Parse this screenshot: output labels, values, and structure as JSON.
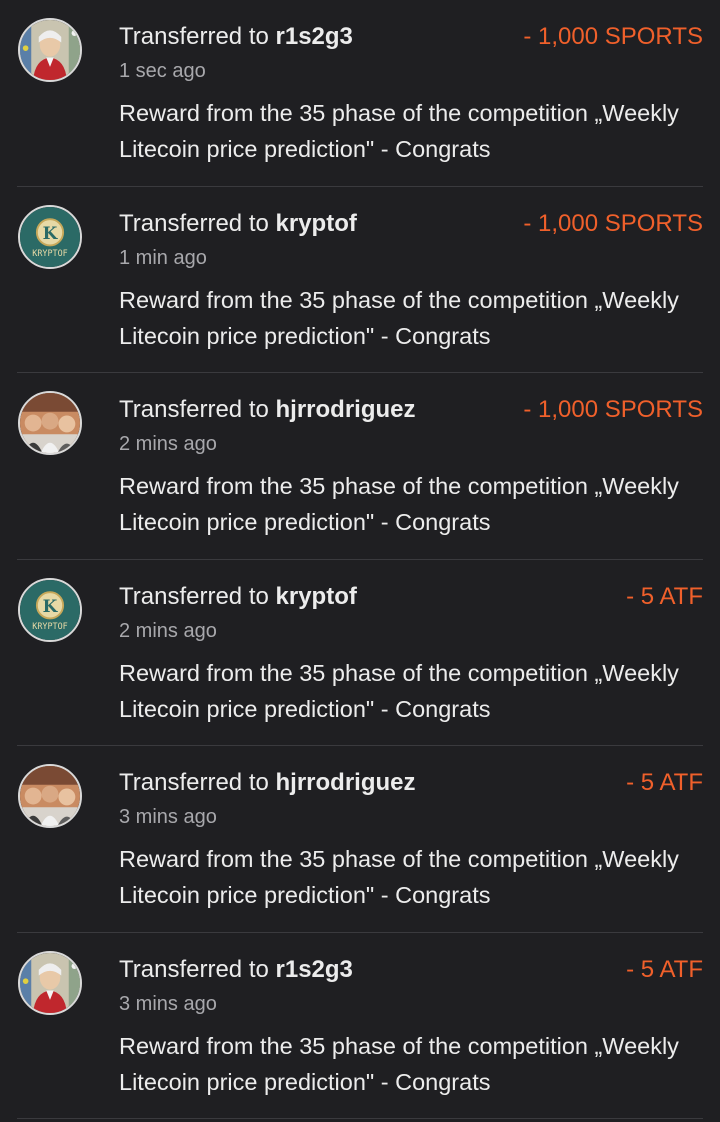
{
  "colors": {
    "background": "#1f1f22",
    "amount": "#f0602b",
    "text": "#ececec",
    "muted": "#a8a8ac",
    "divider": "#3a3a3e"
  },
  "transfers": [
    {
      "prefix": "Transferred to ",
      "user": "r1s2g3",
      "amount": "- 1,000 SPORTS",
      "time": "1 sec ago",
      "memo": "Reward from the 35 phase of the competition „Weekly Litecoin price prediction\" - Congrats",
      "avatar_icon": "portrait-avatar-icon"
    },
    {
      "prefix": "Transferred to ",
      "user": "kryptof",
      "amount": "- 1,000 SPORTS",
      "time": "1 min ago",
      "memo": "Reward from the 35 phase of the competition „Weekly Litecoin price prediction\" - Congrats",
      "avatar_icon": "kryptof-logo-avatar-icon",
      "avatar_logo_text": "KRYPTOF",
      "avatar_logo_letter": "K"
    },
    {
      "prefix": "Transferred to ",
      "user": "hjrrodriguez",
      "amount": "- 1,000 SPORTS",
      "time": "2 mins ago",
      "memo": "Reward from the 35 phase of the competition „Weekly Litecoin price prediction\" - Congrats",
      "avatar_icon": "group-photo-avatar-icon"
    },
    {
      "prefix": "Transferred to ",
      "user": "kryptof",
      "amount": "- 5 ATF",
      "time": "2 mins ago",
      "memo": "Reward from the 35 phase of the competition „Weekly Litecoin price prediction\" - Congrats",
      "avatar_icon": "kryptof-logo-avatar-icon",
      "avatar_logo_text": "KRYPTOF",
      "avatar_logo_letter": "K"
    },
    {
      "prefix": "Transferred to ",
      "user": "hjrrodriguez",
      "amount": "- 5 ATF",
      "time": "3 mins ago",
      "memo": "Reward from the 35 phase of the competition „Weekly Litecoin price prediction\" - Congrats",
      "avatar_icon": "group-photo-avatar-icon"
    },
    {
      "prefix": "Transferred to ",
      "user": "r1s2g3",
      "amount": "- 5 ATF",
      "time": "3 mins ago",
      "memo": "Reward from the 35 phase of the competition „Weekly Litecoin price prediction\" - Congrats",
      "avatar_icon": "portrait-avatar-icon"
    }
  ]
}
